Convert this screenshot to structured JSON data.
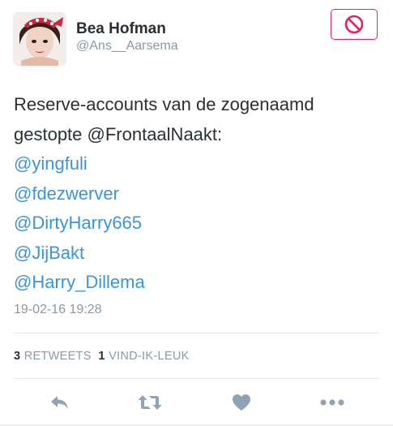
{
  "user": {
    "name": "Bea Hofman",
    "handle": "@Ans__Aarsema"
  },
  "header": {
    "block_icon": "block-icon",
    "accent_color": "#e0245e"
  },
  "tweet": {
    "lines": {
      "line1": "Reserve-accounts van de zogenaamd",
      "line2": "gestopte @FrontaalNaakt:"
    },
    "mentions": [
      "@yingfuli",
      "@fdezwerver",
      "@DirtyHarry665",
      "@JijBakt",
      "@Harry_Dillema"
    ],
    "timestamp": "19-02-16 19:28"
  },
  "stats": {
    "retweets_count": "3",
    "retweets_label": "RETWEETS",
    "likes_count": "1",
    "likes_label": "VIND-IK-LEUK"
  },
  "actions": [
    "reply-icon",
    "retweet-icon",
    "like-icon",
    "more-icon"
  ],
  "colors": {
    "link": "#3b94d9",
    "secondary": "#8899a6",
    "action_icon": "#8fa3b7"
  }
}
